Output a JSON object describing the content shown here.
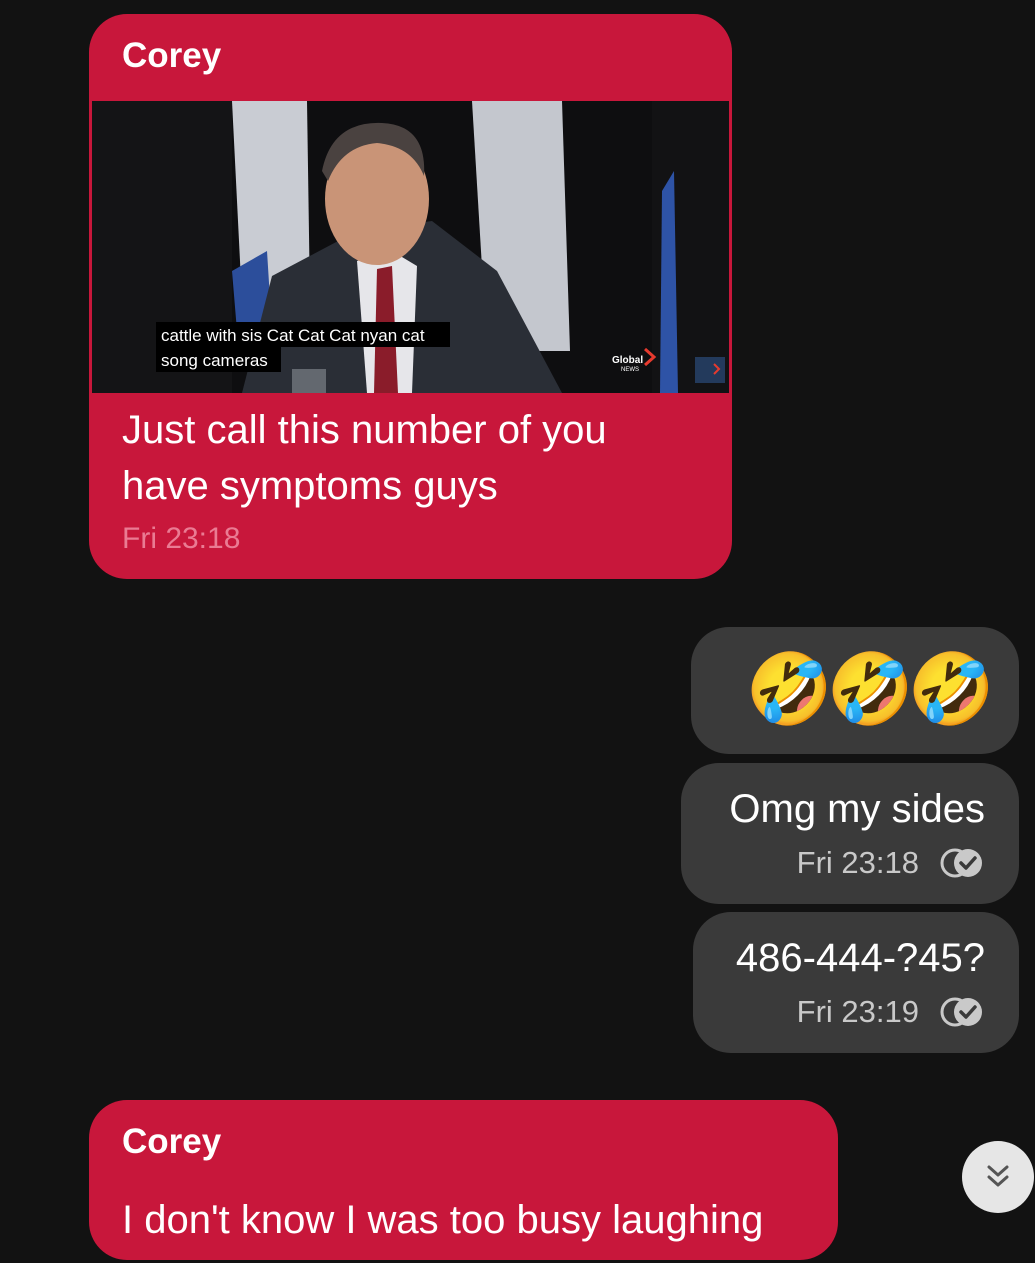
{
  "messages": [
    {
      "sender": "Corey",
      "video": {
        "caption_line1": "cattle with sis Cat Cat Cat nyan cat",
        "caption_line2": "song cameras",
        "network_logo": "Global",
        "network_sub": "NEWS"
      },
      "text_line1": "Just call this number of you",
      "text_line2": "have symptoms guys",
      "time": "Fri 23:18"
    },
    {
      "emojis": "🤣🤣🤣"
    },
    {
      "text": "Omg my sides",
      "time": "Fri 23:18",
      "status_icon": "read-check-icon"
    },
    {
      "text": "486-444-?45?",
      "time": "Fri 23:19",
      "status_icon": "read-check-icon"
    },
    {
      "sender": "Corey",
      "text": "I don't know I was too busy laughing"
    }
  ],
  "scroll_button": {
    "icon": "double-chevron-down-icon"
  },
  "colors": {
    "incoming_bubble": "#c8173b",
    "outgoing_bubble": "#3a3a3a",
    "background": "#121212"
  }
}
